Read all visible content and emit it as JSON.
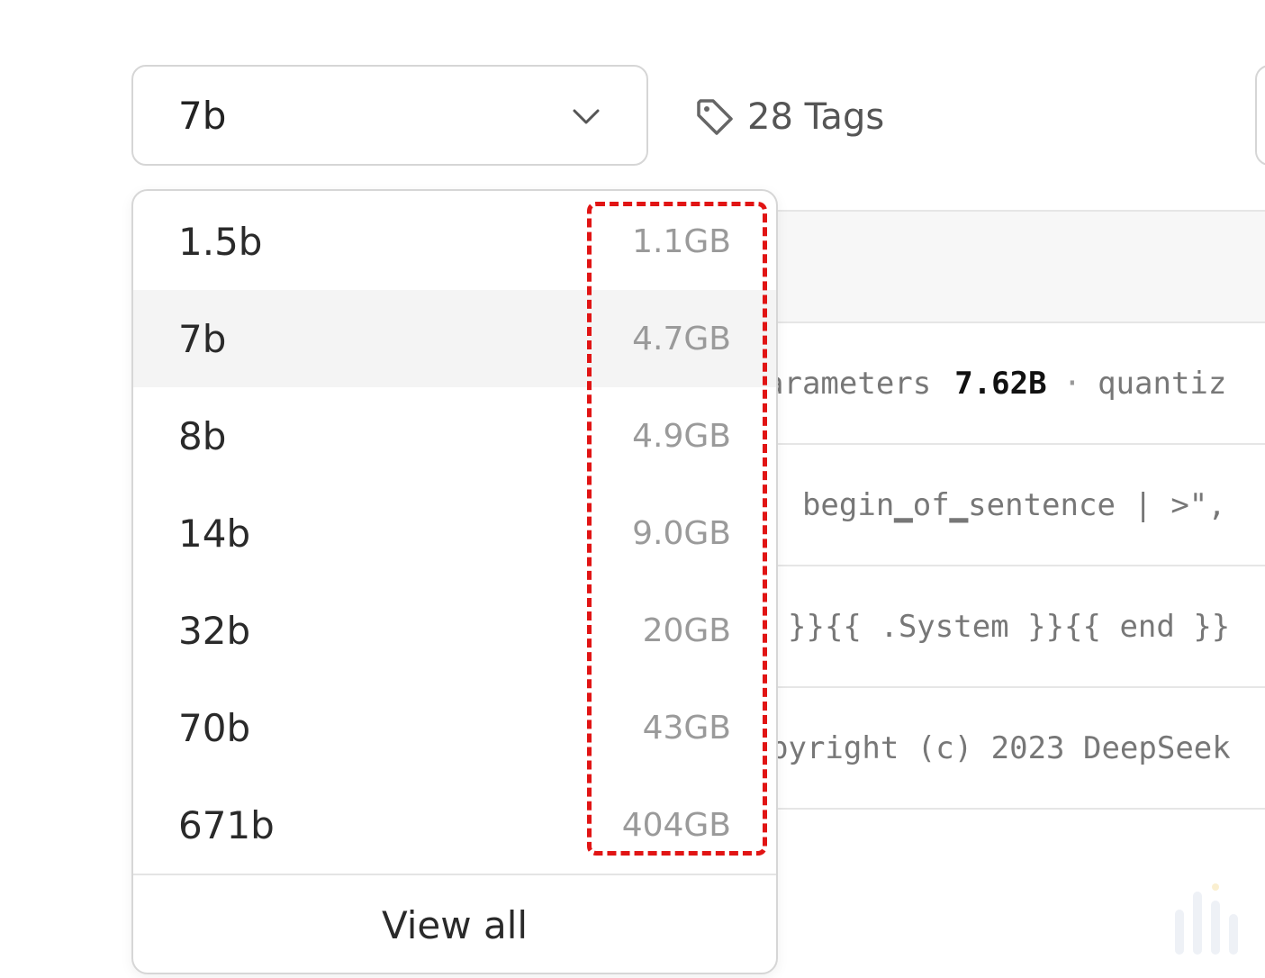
{
  "selector": {
    "value": "7b"
  },
  "tags": {
    "label": "28 Tags"
  },
  "dropdown": {
    "items": [
      {
        "label": "1.5b",
        "size": "1.1GB"
      },
      {
        "label": "7b",
        "size": "4.7GB",
        "selected": true
      },
      {
        "label": "8b",
        "size": "4.9GB"
      },
      {
        "label": "14b",
        "size": "9.0GB"
      },
      {
        "label": "32b",
        "size": "20GB"
      },
      {
        "label": "70b",
        "size": "43GB"
      },
      {
        "label": "671b",
        "size": "404GB"
      }
    ],
    "view_all": "View all"
  },
  "background": {
    "row1": {
      "prefix": "arameters",
      "value": "7.62B",
      "sep": "·",
      "suffix": "quantiz"
    },
    "row2": "| begin▁of▁sentence | >\",",
    "row3": "}}{{ .System }}{{ end }}",
    "row4": "pyright (c) 2023 DeepSeek"
  },
  "colors": {
    "highlight": "#e11414",
    "selected_bg": "#f4f4f4"
  }
}
